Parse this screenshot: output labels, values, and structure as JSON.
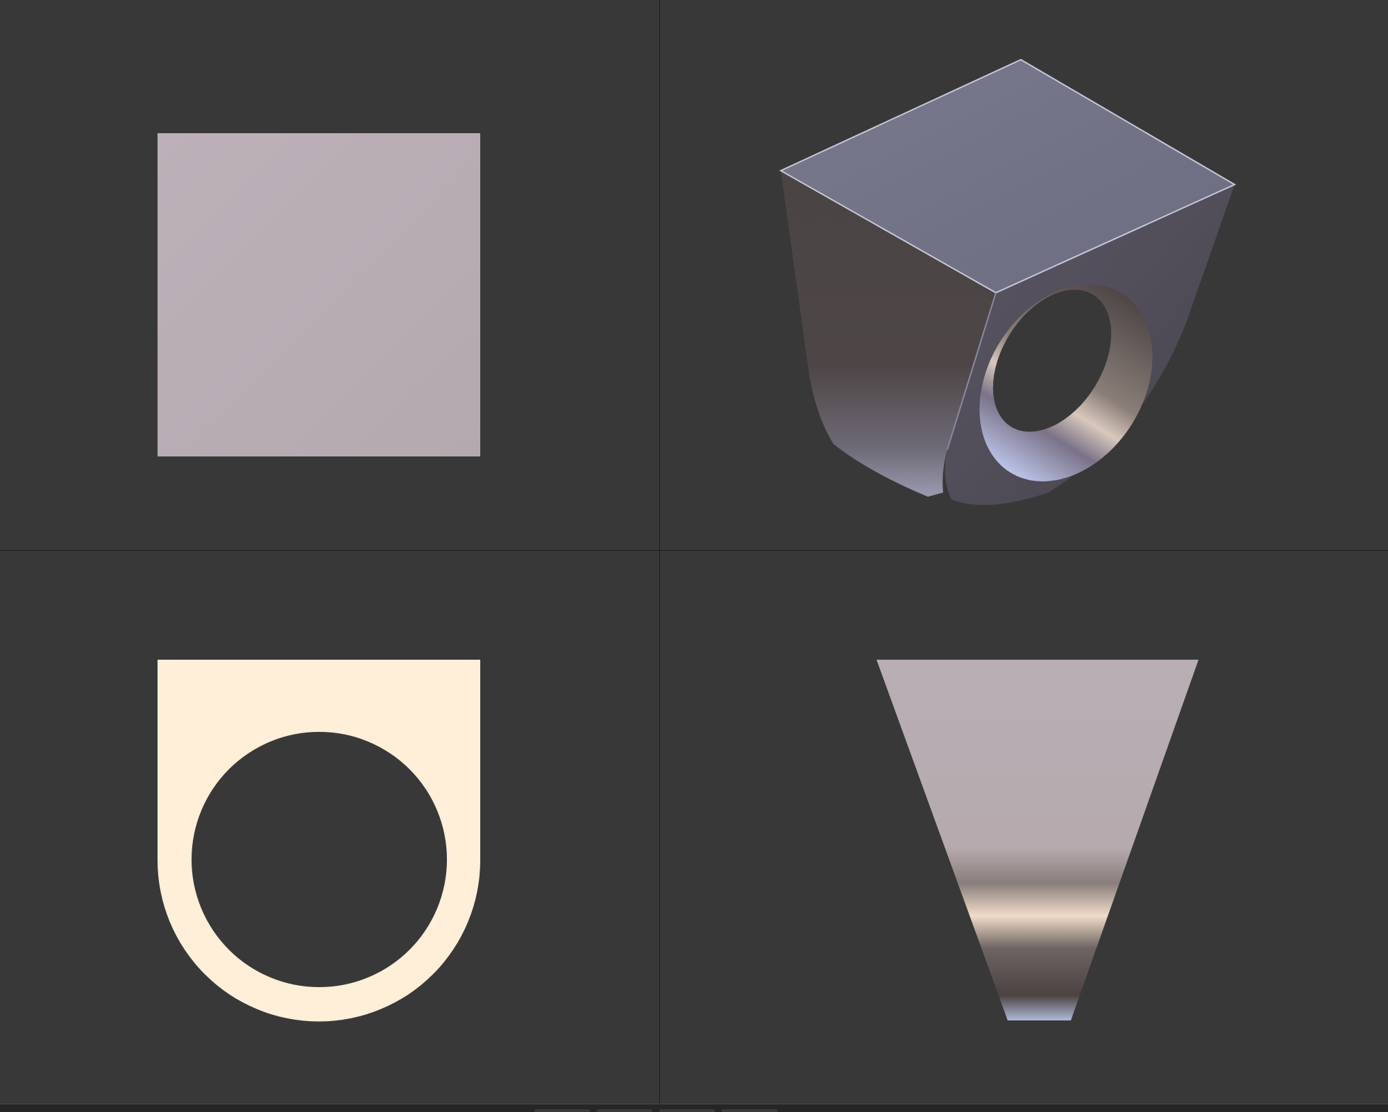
{
  "viewports": [
    {
      "id": "top",
      "label": "",
      "object": "ring-top-view"
    },
    {
      "id": "perspective",
      "label": "",
      "object": "ring-perspective-view"
    },
    {
      "id": "front",
      "label": "",
      "object": "ring-front-view"
    },
    {
      "id": "right",
      "label": "",
      "object": "ring-side-view"
    }
  ],
  "colors": {
    "background": "#383838",
    "divider": "#1c1c1c",
    "top_face": "#b8aeb4",
    "front_face_fill": "#ffefd9",
    "perspective_top": "#76768a",
    "perspective_side": "#4e4444",
    "metal_highlight": "#efd8c4"
  },
  "bottom_bar": {
    "tabs": 4
  }
}
